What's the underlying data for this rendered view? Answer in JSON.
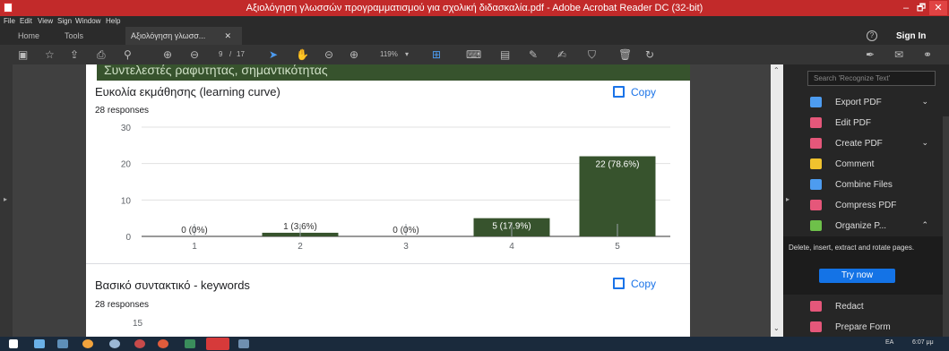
{
  "window": {
    "title": "Αξιολόγηση γλωσσών προγραμματισμού για σχολική διδασκαλία.pdf - Adobe Acrobat Reader DC (32-bit)",
    "min": "–",
    "max": "🗗",
    "close": "✕"
  },
  "menu": [
    "File",
    "Edit",
    "View",
    "Sign",
    "Window",
    "Help"
  ],
  "tabs": {
    "home": "Home",
    "tools": "Tools",
    "doc": "Αξιολόγηση γλωσσ...",
    "doc_close": "✕",
    "help": "?",
    "signin": "Sign In"
  },
  "toolbar": {
    "page_current": "9",
    "page_sep": "/",
    "page_total": "17",
    "zoom": "119%"
  },
  "document": {
    "band_text": "Συντελεστές ραφυτητας, σημαντικότητας",
    "q1": {
      "title": "Ευκολία εκμάθησης (learning curve)",
      "responses": "28 responses",
      "copy": "Copy"
    },
    "q2": {
      "title": "Βασικό συντακτικό - keywords",
      "responses": "28 responses",
      "copy": "Copy",
      "first_tick": "15"
    }
  },
  "chart_data": {
    "type": "bar",
    "categories": [
      "1",
      "2",
      "3",
      "4",
      "5"
    ],
    "values": [
      0,
      1,
      0,
      5,
      22
    ],
    "data_labels": [
      "0 (0%)",
      "1 (3.6%)",
      "0 (0%)",
      "5 (17.9%)",
      "22 (78.6%)"
    ],
    "yticks": [
      "0",
      "10",
      "20",
      "30"
    ],
    "ylim": [
      0,
      30
    ],
    "grid": true,
    "bar_color": "#37532d"
  },
  "panel": {
    "search_placeholder": "Search 'Recognize Text'",
    "items": [
      {
        "label": "Export PDF",
        "icon": "export-pdf-icon",
        "color": "#4d9cf0",
        "chev": "⌄"
      },
      {
        "label": "Edit PDF",
        "icon": "edit-pdf-icon",
        "color": "#e5577a",
        "chev": ""
      },
      {
        "label": "Create PDF",
        "icon": "create-pdf-icon",
        "color": "#e5577a",
        "chev": "⌄"
      },
      {
        "label": "Comment",
        "icon": "comment-icon",
        "color": "#f0c22e",
        "chev": ""
      },
      {
        "label": "Combine Files",
        "icon": "combine-files-icon",
        "color": "#4d9cf0",
        "chev": ""
      },
      {
        "label": "Compress PDF",
        "icon": "compress-pdf-icon",
        "color": "#e5577a",
        "chev": ""
      },
      {
        "label": "Organize P...",
        "icon": "organize-pages-icon",
        "color": "#6ec04a",
        "chev": "⌃"
      }
    ],
    "organize_desc": "Delete, insert, extract and rotate pages.",
    "try_now": "Try now",
    "bottom_items": [
      {
        "label": "Redact",
        "icon": "redact-icon",
        "color": "#e5577a"
      },
      {
        "label": "Prepare Form",
        "icon": "prepare-form-icon",
        "color": "#e5577a"
      }
    ]
  },
  "taskbar": {
    "lang": "EA",
    "time": "6:07 μμ"
  }
}
